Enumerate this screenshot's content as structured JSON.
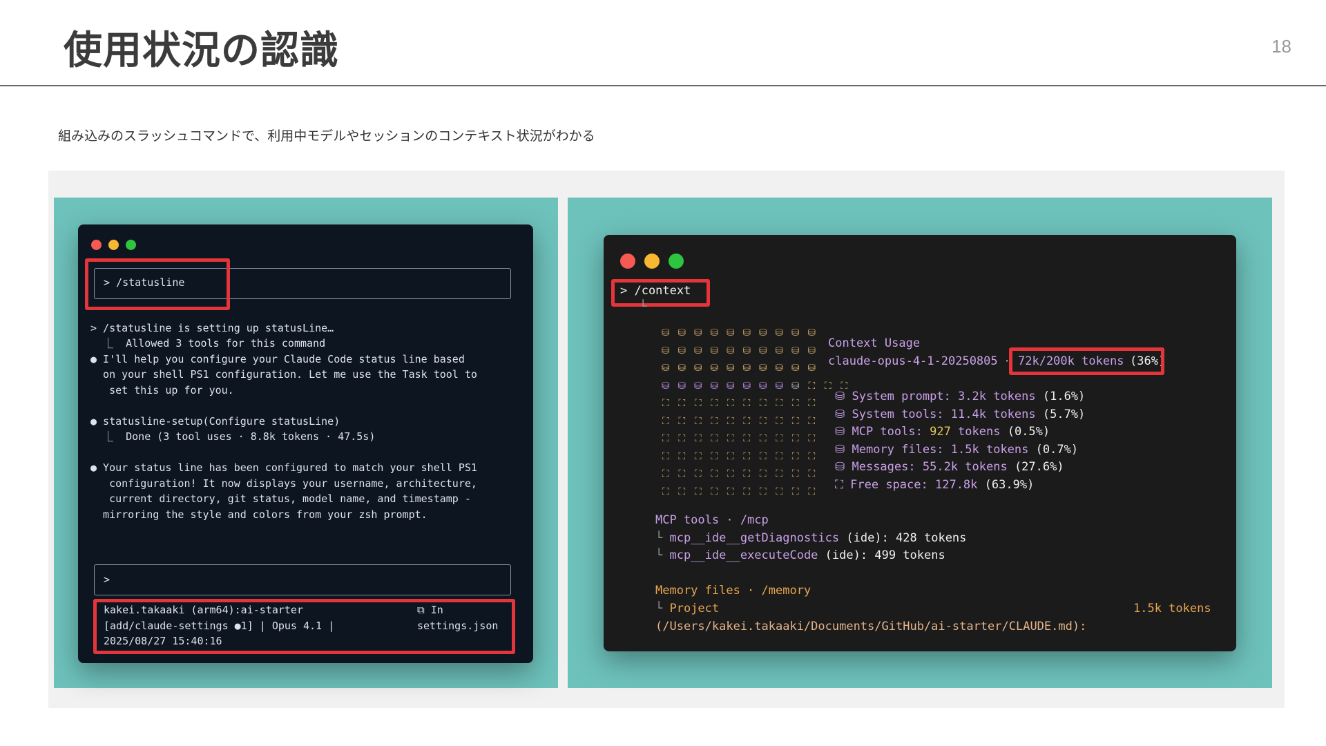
{
  "slide": {
    "title": "使用状況の認識",
    "page_number": "18",
    "subtitle": "組み込みのスラッシュコマンドで、利用中モデルやセッションのコンテキスト状況がわかる"
  },
  "left_terminal": {
    "command": "> /statusline",
    "lines": [
      "> /statusline is setting up statusLine…",
      "  ⎿  Allowed 3 tools for this command",
      "● I'll help you configure your Claude Code status line based",
      "  on your shell PS1 configuration. Let me use the Task tool to",
      "   set this up for you.",
      "● statusline-setup(Configure statusLine)",
      "  ⎿  Done (3 tool uses · 8.8k tokens · 47.5s)",
      "● Your status line has been configured to match your shell PS1",
      "   configuration! It now displays your username, architecture,",
      "   current directory, git status, model name, and timestamp -",
      "  mirroring the style and colors from your zsh prompt."
    ],
    "prompt": ">",
    "status_left": [
      "kakei.takaaki (arm64):ai-starter",
      "[add/claude-settings ●1] | Opus 4.1 |",
      "2025/08/27 15:40:16"
    ],
    "status_right": [
      "⧉ In",
      "settings.json"
    ]
  },
  "right_terminal": {
    "command": "> /context",
    "tree_corner": "└",
    "grid_rows": [
      "uuuuuuuuuu",
      "uuuuuuuuuu",
      "uuuuuuuuuu",
      "uuuuuuuumfff",
      "ffffffffff",
      "ffffffffff",
      "ffffffffff",
      "ffffffffff",
      "ffffffffff",
      "ffffffffff"
    ],
    "glyph_used": "⛁",
    "glyph_free": "⛶",
    "context_title": "Context Usage",
    "model": "claude-opus-4-1-20250805",
    "separator": "·",
    "tokens_total": "72k/200k tokens",
    "tokens_pct": "(36%)",
    "breakdown": [
      {
        "label": "System prompt:",
        "value": "3.2k tokens",
        "pct": "(1.6%)"
      },
      {
        "label": "System tools:",
        "value": "11.4k tokens",
        "pct": "(5.7%)"
      },
      {
        "label": "MCP tools:",
        "value_highlight": "927",
        "value": " tokens",
        "pct": "(0.5%)"
      },
      {
        "label": "Memory files:",
        "value": "1.5k tokens",
        "pct": "(0.7%)"
      },
      {
        "label": "Messages:",
        "value": "55.2k tokens",
        "pct": "(27.6%)"
      },
      {
        "label": "Free space:",
        "value": "127.8k",
        "pct": "(63.9%)"
      }
    ],
    "mcp_section": "MCP tools · /mcp",
    "mcp_items": [
      {
        "name": "mcp__ide__getDiagnostics",
        "paren": "(ide)",
        "tokens": "428 tokens"
      },
      {
        "name": "mcp__ide__executeCode",
        "paren": "(ide)",
        "tokens": "499 tokens"
      }
    ],
    "memory_section": "Memory files · /memory",
    "memory_item": "Project",
    "memory_tokens": "1.5k tokens",
    "memory_path": "(/Users/kakei.takaaki/Documents/GitHub/ai-starter/CLAUDE.md):"
  },
  "colors": {
    "accent_highlight": "#e3353a",
    "panel_teal": "#6ec2bc",
    "terminal_left_bg": "#0d1520",
    "terminal_right_bg": "#1b1b1b"
  }
}
